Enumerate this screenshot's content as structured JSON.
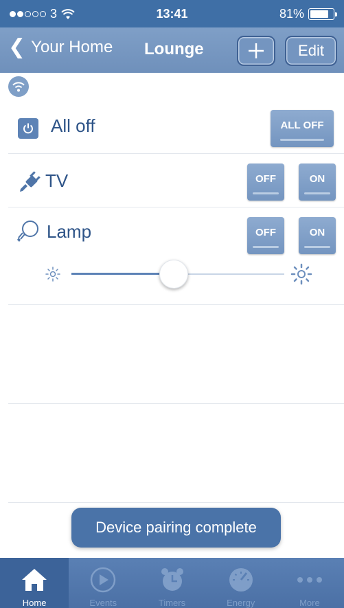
{
  "status_bar": {
    "carrier": "3",
    "time": "13:41",
    "battery": "81%",
    "battery_level": 0.81
  },
  "nav": {
    "back_label": "Your Home",
    "title": "Lounge",
    "edit_label": "Edit"
  },
  "devices": {
    "all_off": {
      "label": "All off",
      "button": "ALL OFF"
    },
    "tv": {
      "label": "TV",
      "off": "OFF",
      "on": "ON"
    },
    "lamp": {
      "label": "Lamp",
      "off": "OFF",
      "on": "ON",
      "brightness": 0.48
    }
  },
  "toast": "Device pairing complete",
  "tabs": [
    {
      "label": "Home"
    },
    {
      "label": "Events"
    },
    {
      "label": "Timers"
    },
    {
      "label": "Energy"
    },
    {
      "label": "More"
    }
  ],
  "colors": {
    "accent": "#5d83b6",
    "nav": "#7495c0",
    "text": "#2e5488"
  }
}
